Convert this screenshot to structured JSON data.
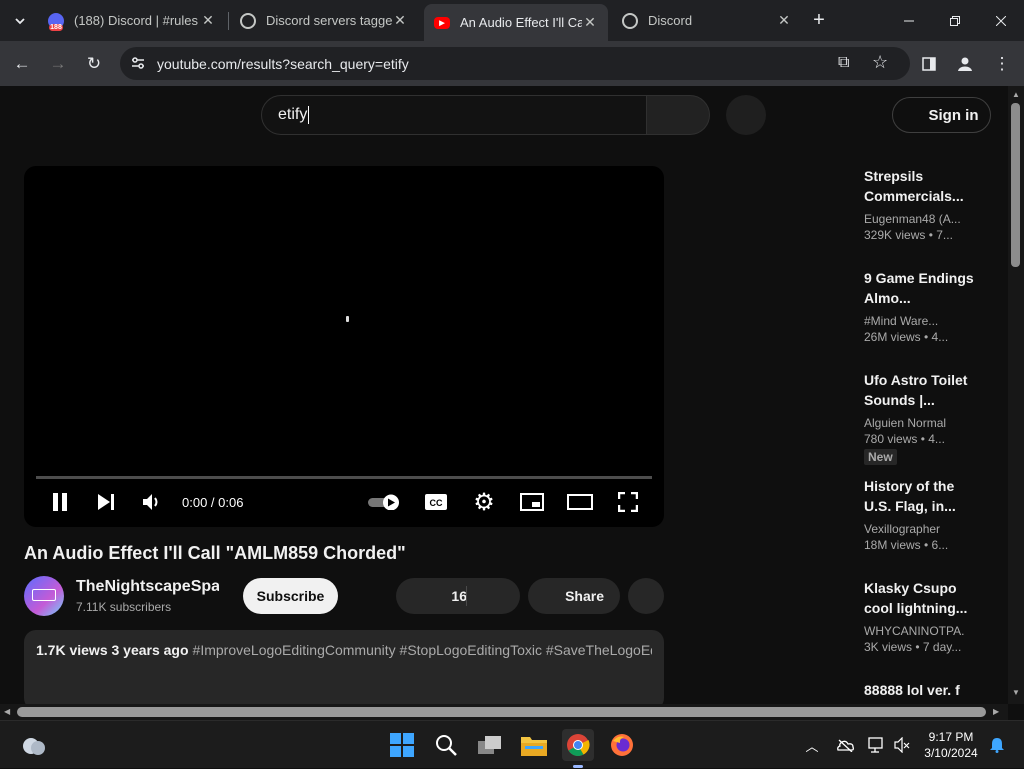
{
  "tabs": [
    {
      "title": "(188) Discord | #rules |",
      "badge": "188",
      "active": false
    },
    {
      "title": "Discord servers tagged",
      "active": false
    },
    {
      "title": "An Audio Effect I'll Call",
      "active": true
    },
    {
      "title": "Discord",
      "active": false
    }
  ],
  "browser": {
    "url": "youtube.com/results?search_query=etify"
  },
  "youtube": {
    "search_value": "etify",
    "sign_in": "Sign in",
    "player": {
      "time": "0:00 / 0:06"
    },
    "video_title": "An Audio Effect I'll Call \"AMLM859 Chorded\"",
    "channel_name": "TheNightscapeSpark",
    "subscribers": "7.11K subscribers",
    "subscribe_label": "Subscribe",
    "likes": "16",
    "share_label": "Share",
    "description": {
      "meta": "1.7K views  3 years ago",
      "tags": "#ImproveLogoEditingCommunity #StopLogoEditingToxic #SaveTheLogoEditingCommunity",
      "text_before": "",
      "mention": "",
      "text_after": ""
    },
    "recommendations": [
      {
        "title": "Strepsils Commercials...",
        "channel": "Eugenman48 (A...",
        "views": "329K views  • 7..."
      },
      {
        "title": "9 Game Endings Almo...",
        "channel": "#Mind Ware...",
        "views": "26M views  • 4..."
      },
      {
        "title": "Ufo Astro Toilet Sounds |...",
        "channel": "Alguien Normal",
        "views": "780 views  • 4...",
        "badge": "New"
      },
      {
        "title": "History of the U.S. Flag, in...",
        "channel": "Vexillographer",
        "views": "18M views  • 6..."
      },
      {
        "title": "Klasky Csupo cool lightning...",
        "channel": "WHYCANINOTPA...",
        "views": "3K views  • 7 day..."
      },
      {
        "title": "88888 lol ver. f",
        "channel": "",
        "views": ""
      }
    ]
  },
  "taskbar": {
    "time": "9:17 PM",
    "date": "3/10/2024"
  },
  "colors": {
    "youtube_red": "#ff0000",
    "discord_blurple": "#5865f2",
    "link_blue": "#3ea6ff",
    "page_bg": "#0f0f0f"
  }
}
